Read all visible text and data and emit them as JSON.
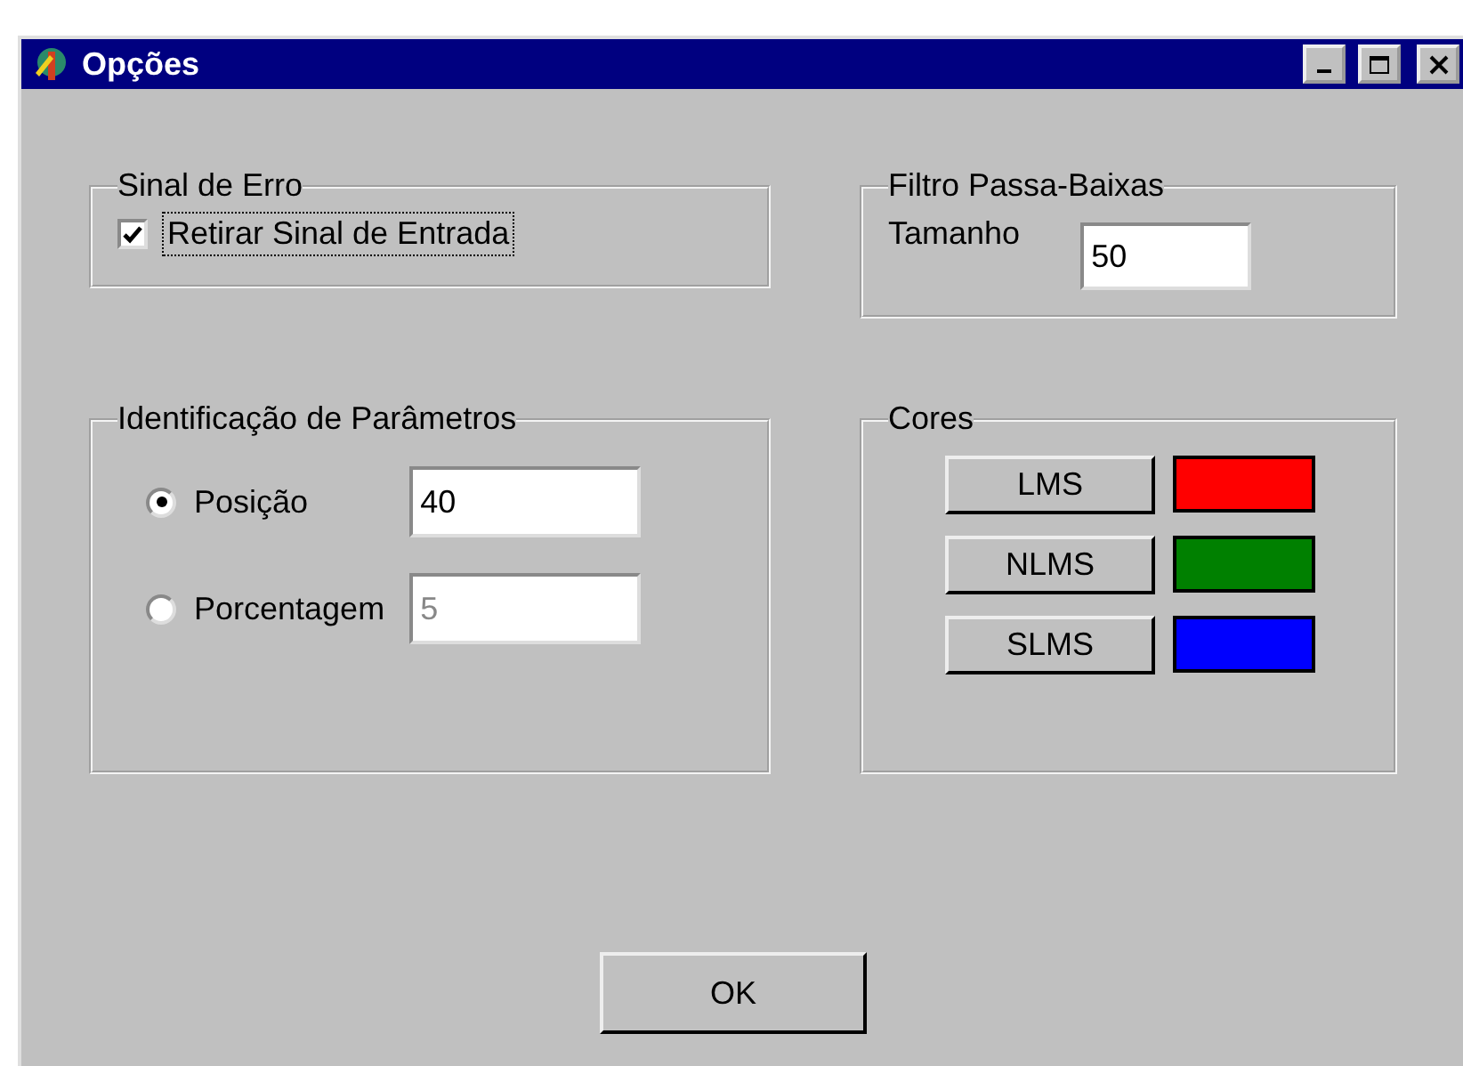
{
  "window": {
    "title": "Opções"
  },
  "signal_error": {
    "title": "Sinal de Erro",
    "checkbox": {
      "label": "Retirar Sinal de Entrada",
      "checked": true,
      "focused": true
    }
  },
  "low_pass": {
    "title": "Filtro Passa-Baixas",
    "label": "Tamanho",
    "value": "50"
  },
  "identification": {
    "title": "Identificação de Parâmetros",
    "options": [
      {
        "label": "Posição",
        "selected": true,
        "value": "40",
        "disabled": false
      },
      {
        "label": "Porcentagem",
        "selected": false,
        "value": "5",
        "disabled": true
      }
    ]
  },
  "colors": {
    "title": "Cores",
    "items": [
      {
        "label": "LMS",
        "color": "#ff0000"
      },
      {
        "label": "NLMS",
        "color": "#008000"
      },
      {
        "label": "SLMS",
        "color": "#0000ff"
      }
    ]
  },
  "ok_button": "OK"
}
